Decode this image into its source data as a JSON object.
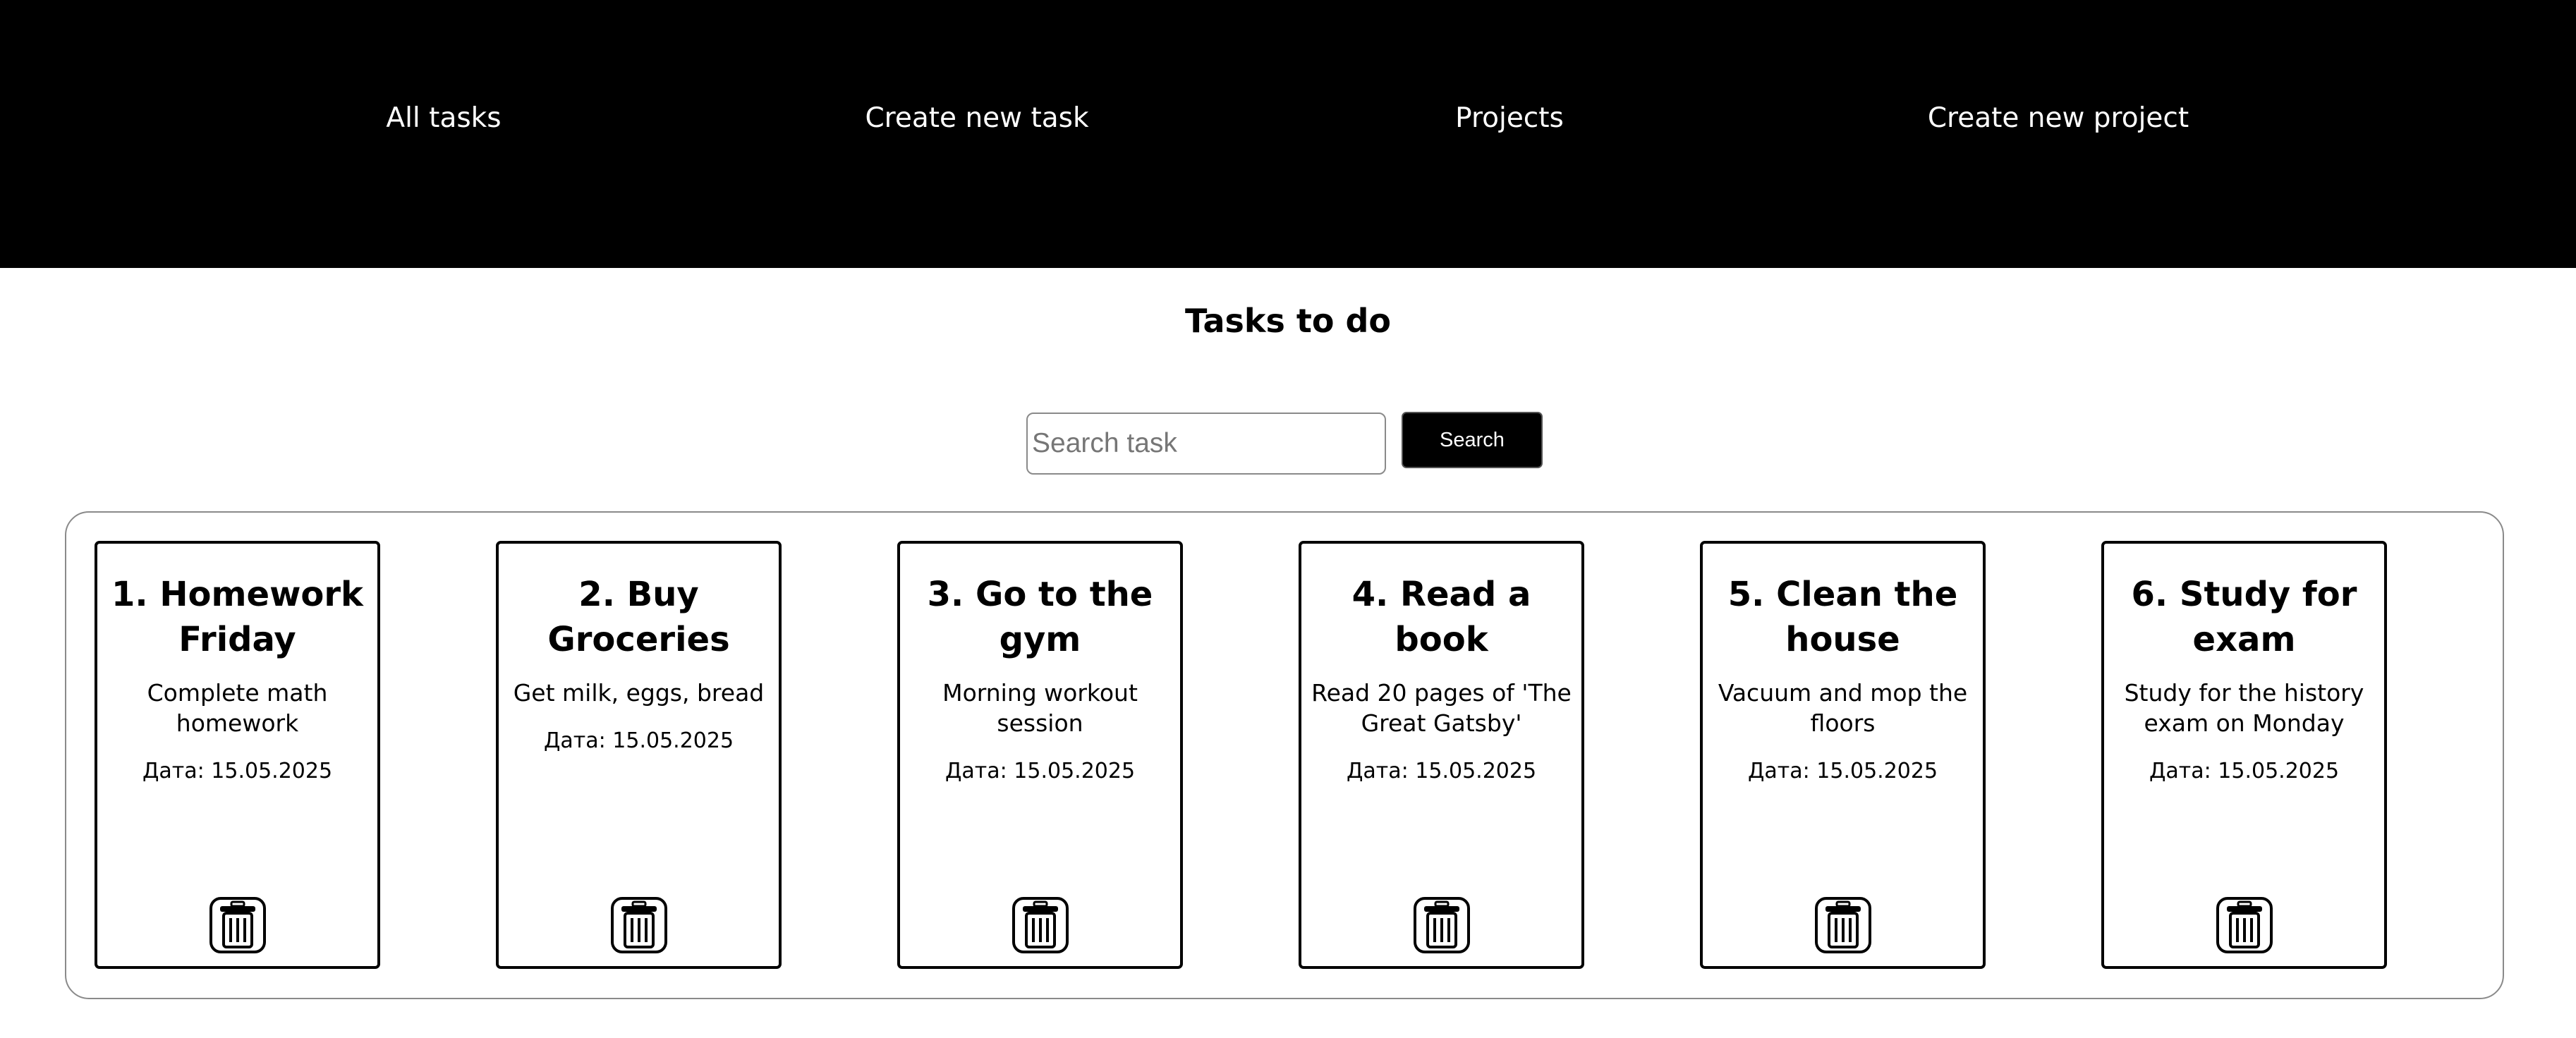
{
  "nav": {
    "items": [
      {
        "label": "All tasks"
      },
      {
        "label": "Create new task"
      },
      {
        "label": "Projects"
      },
      {
        "label": "Create new project"
      }
    ]
  },
  "page": {
    "title": "Tasks to do"
  },
  "search": {
    "placeholder": "Search task",
    "value": "",
    "button_label": "Search"
  },
  "tasks": [
    {
      "title": "1. Homework Friday",
      "description": "Complete math homework",
      "date": "Дата: 15.05.2025",
      "delete_icon": "trash-icon"
    },
    {
      "title": "2. Buy Groceries",
      "description": "Get milk, eggs, bread",
      "date": "Дата: 15.05.2025",
      "delete_icon": "trash-icon"
    },
    {
      "title": "3. Go to the gym",
      "description": "Morning workout session",
      "date": "Дата: 15.05.2025",
      "delete_icon": "trash-icon"
    },
    {
      "title": "4. Read a book",
      "description": "Read 20 pages of 'The Great Gatsby'",
      "date": "Дата: 15.05.2025",
      "delete_icon": "trash-icon"
    },
    {
      "title": "5. Clean the house",
      "description": "Vacuum and mop the floors",
      "date": "Дата: 15.05.2025",
      "delete_icon": "trash-icon"
    },
    {
      "title": "6. Study for exam",
      "description": "Study for the history exam on Monday",
      "date": "Дата: 15.05.2025",
      "delete_icon": "trash-icon"
    }
  ],
  "colors": {
    "navbar": "#000000",
    "nav_text": "#ffffff",
    "button": "#000000",
    "card_border": "#000000",
    "board_border": "#8a8a8a"
  }
}
